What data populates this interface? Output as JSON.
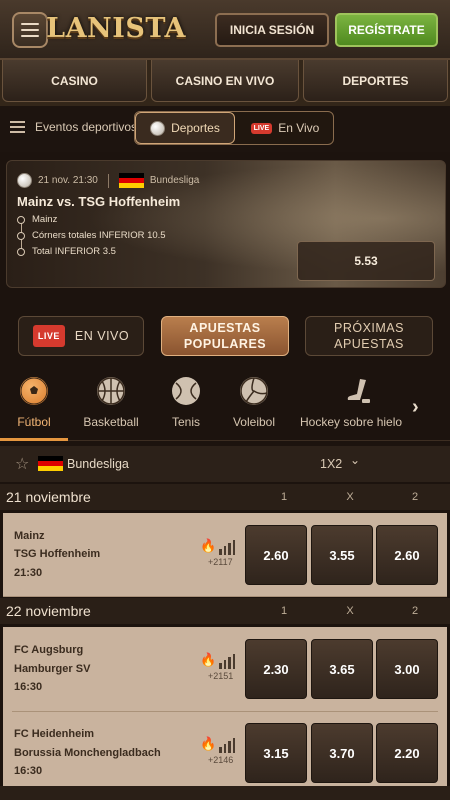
{
  "header": {
    "logo_text": "LANISTA",
    "login_label": "INICIA SESIÓN",
    "register_label": "REGÍSTRATE"
  },
  "top_nav": [
    "CASINO",
    "CASINO EN VIVO",
    "DEPORTES"
  ],
  "sub_nav": {
    "label": "Eventos deportivos",
    "sports_label": "Deportes",
    "live_badge": "LIVE",
    "live_label": "En Vivo"
  },
  "featured": {
    "date": "21 nov. 21:30",
    "league": "Bundesliga",
    "title": "Mainz vs. TSG Hoffenheim",
    "selections": [
      "Mainz",
      "Córners totales INFERIOR 10.5",
      "Total INFERIOR 3.5"
    ],
    "odds": "5.53"
  },
  "filters": {
    "live_badge": "LIVE",
    "live_label": "EN VIVO",
    "popular_line1": "APUESTAS",
    "popular_line2": "POPULARES",
    "next_line1": "PRÓXIMAS",
    "next_line2": "APUESTAS"
  },
  "sports": [
    {
      "label": "Fútbol",
      "icon": "soccer-ball-icon"
    },
    {
      "label": "Basketball",
      "icon": "basketball-icon"
    },
    {
      "label": "Tenis",
      "icon": "tennis-ball-icon"
    },
    {
      "label": "Voleibol",
      "icon": "volleyball-icon"
    },
    {
      "label": "Hockey sobre hielo",
      "icon": "hockey-stick-icon"
    }
  ],
  "league_bar": {
    "name": "Bundesliga",
    "market": "1X2"
  },
  "columns": [
    "1",
    "X",
    "2"
  ],
  "days": [
    {
      "date": "21 noviembre",
      "matches": [
        {
          "home": "Mainz",
          "away": "TSG Hoffenheim",
          "time": "21:30",
          "markets": "+2117",
          "odds": [
            "2.60",
            "3.55",
            "2.60"
          ]
        }
      ]
    },
    {
      "date": "22 noviembre",
      "matches": [
        {
          "home": "FC Augsburg",
          "away": "Hamburger SV",
          "time": "16:30",
          "markets": "+2151",
          "odds": [
            "2.30",
            "3.65",
            "3.00"
          ]
        },
        {
          "home": "FC Heidenheim",
          "away": "Borussia Monchengladbach",
          "time": "16:30",
          "markets": "+2146",
          "odds": [
            "3.15",
            "3.70",
            "2.20"
          ]
        }
      ]
    }
  ],
  "colors": {
    "accent_orange": "#e5963f",
    "register_green": "#6aa132",
    "live_red": "#d53a2e",
    "card_beige": "#c9b39e"
  }
}
